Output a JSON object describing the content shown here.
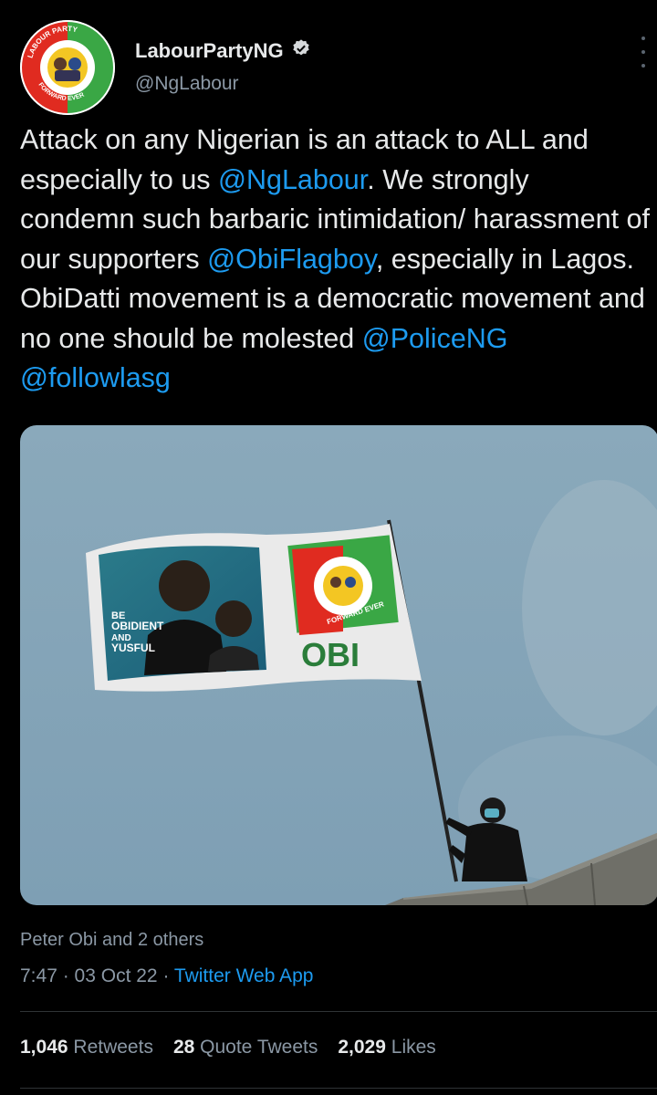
{
  "author": {
    "display_name": "LabourPartyNG",
    "handle": "@NgLabour",
    "logo_text": {
      "top": "LABOUR PARTY",
      "bottom": "FORWARD EVER"
    }
  },
  "tweet": {
    "parts": [
      "Attack on any Nigerian is an attack to ALL and especially to us ",
      "@NgLabour",
      ". We strongly condemn such barbaric intimidation/ harassment of our supporters ",
      "@ObiFlagboy",
      ", especially in Lagos. ObiDatti movement is a democratic movement and no one should be molested ",
      "@PoliceNG",
      " ",
      "@followlasg"
    ]
  },
  "media": {
    "flag_left_text": {
      "slogan_1": "BE",
      "slogan_2": "OBIDIENT",
      "slogan_3": "AND",
      "slogan_4": "YUSFUL"
    },
    "flag_right_text": {
      "logo_bottom": "FORWARD EVER",
      "name": "OBI"
    }
  },
  "footer": {
    "liked_by": "Peter Obi and 2 others",
    "time": "7:47",
    "date": "03 Oct 22",
    "sep": " · ",
    "source": "Twitter Web App"
  },
  "stats": {
    "retweets_count": "1,046",
    "retweets_label": "Retweets",
    "quotes_count": "28",
    "quotes_label": "Quote Tweets",
    "likes_count": "2,029",
    "likes_label": "Likes"
  },
  "colors": {
    "background": "#000000",
    "text": "#e7e9ea",
    "secondary": "#8b98a5",
    "link": "#1d9bf0",
    "logo_red": "#e02b20",
    "logo_green": "#3aa745"
  },
  "icons": {
    "verified": "verified-badge-icon",
    "more": "more-options-icon"
  }
}
